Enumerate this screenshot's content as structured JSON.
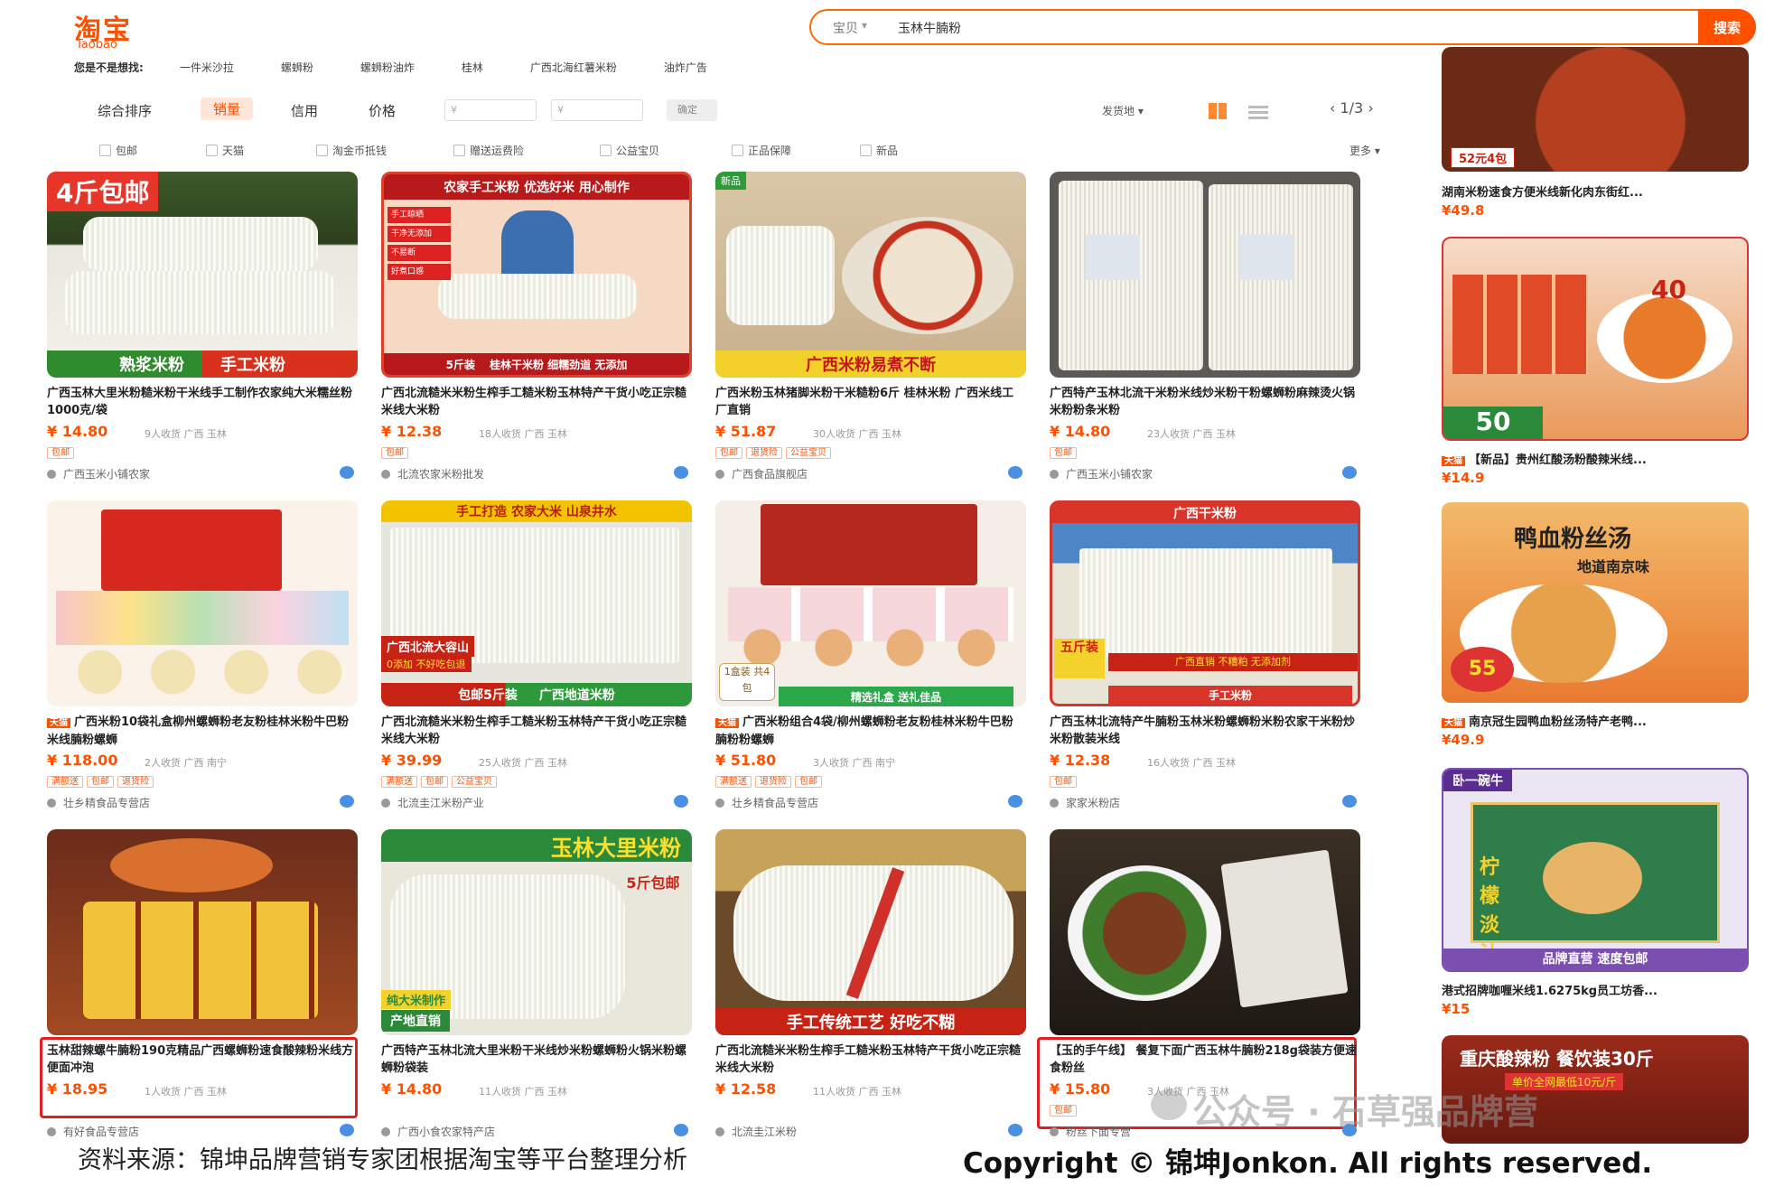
{
  "header": {
    "logo_cn": "淘宝",
    "logo_en": "Taobao",
    "search_category": "宝贝",
    "search_query": "玉林牛腩粉",
    "search_button": "搜索"
  },
  "keywords": {
    "lead": "您是不是想找:",
    "items": [
      "一件米沙拉",
      "螺蛳粉",
      "螺蛳粉油炸",
      "桂林",
      "广西北海红薯米粉",
      "油炸广告"
    ]
  },
  "sortbar": {
    "items": [
      "综合排序",
      "销量",
      "信用",
      "价格"
    ],
    "active": "销量",
    "price_from_placeholder": "¥",
    "price_to_placeholder": "¥",
    "ok_label": "确定",
    "view_select": "发货地",
    "pager": "1/3"
  },
  "filters": {
    "items": [
      "包邮",
      "天猫",
      "淘金币抵钱",
      "赠送运费险",
      "公益宝贝",
      "正品保障",
      "新品"
    ],
    "more": "更多"
  },
  "products": [
    {
      "badge": "4斤包邮",
      "caption_left": "熟浆米粉",
      "caption_right": "手工米粉",
      "title": "广西玉林大里米粉糙米粉干米线手工制作农家纯大米糯丝粉1000克/袋",
      "price": "¥ 14.80",
      "meta": "9人收货  广西 玉林",
      "tags": [
        "包邮"
      ],
      "shop": "广西玉米小铺农家",
      "boxed": false
    },
    {
      "top_text": "农家手工米粉 优选好米 用心制作",
      "tags_img": [
        "手工晾晒",
        "干净无添加",
        "不易断",
        "好煮口感"
      ],
      "caption_left": "5斤装",
      "caption_right": "桂林干米粉 细糯劲道 无添加",
      "title": "广西北流糙米米粉生榨手工糙米粉玉林特产干货小吃正宗糙米线大米粉",
      "price": "¥ 12.38",
      "meta": "18人收货  广西 玉林",
      "tags": [
        "包邮"
      ],
      "shop": "北流农家米粉批发",
      "boxed": false
    },
    {
      "corner": "新品",
      "caption_left": "广西米粉易煮不断",
      "title": "广西米粉玉林猪脚米粉干米糙粉6斤 桂林米粉 广西米线工厂直销",
      "price": "¥ 51.87",
      "meta": "30人收货  广西 玉林",
      "tags": [
        "包邮",
        "退货险",
        "公益宝贝"
      ],
      "shop": "广西食品旗舰店",
      "boxed": false
    },
    {
      "title": "广西特产玉林北流干米粉米线炒米粉干粉螺蛳粉麻辣烫火锅米粉粉条米粉",
      "price": "¥ 14.80",
      "meta": "23人收货  广西 玉林",
      "tags": [
        "包邮"
      ],
      "shop": "广西玉米小铺农家",
      "boxed": false
    },
    {
      "title": "广西米粉10袋礼盒柳州螺蛳粉老友粉桂林米粉牛巴粉米线腩粉螺蛳",
      "price": "¥ 118.00",
      "meta": "2人收货  广西 南宁",
      "tags": [
        "满额送",
        "包邮",
        "退货险"
      ],
      "shop": "壮乡精食品专营店",
      "boxed": false,
      "label": "天猫"
    },
    {
      "top_text": "手工打造 农家大米 山泉井水",
      "mid_text": "广西北流大容山",
      "mid_text2": "0添加 不好吃包退",
      "caption_left": "包邮5斤装",
      "caption_right": "广西地道米粉",
      "title": "广西北流糙米米粉生榨手工糙米粉玉林特产干货小吃正宗糙米线大米粉",
      "price": "¥ 39.99",
      "meta": "25人收货  广西 玉林",
      "tags": [
        "满额送",
        "包邮",
        "公益宝贝"
      ],
      "shop": "北流圭江米粉产业",
      "boxed": false
    },
    {
      "corner_text": "1盒装 共4包",
      "caption_left": "精选礼盒 送礼佳品",
      "title": "广西米粉组合4袋/柳州螺蛳粉老友粉桂林米粉牛巴粉腩粉粉螺蛳",
      "price": "¥ 51.80",
      "meta": "3人收货  广西 南宁",
      "tags": [
        "满额送",
        "退货险",
        "包邮"
      ],
      "shop": "壮乡精食品专营店",
      "boxed": false,
      "label": "天猫"
    },
    {
      "top_text": "广西干米粉",
      "corner_text": "五斤装",
      "caption_left": "广西直销 不糟粕 无添加剂",
      "caption_right": "手工米粉",
      "title": "广西玉林北流特产牛腩粉玉林米粉螺蛳粉米粉农家干米粉炒米粉散装米线",
      "price": "¥ 12.38",
      "meta": "16人收货  广西 玉林",
      "tags": [
        "包邮"
      ],
      "shop": "家家米粉店",
      "boxed": false
    },
    {
      "title": "玉林甜辣螺牛腩粉190克精品广西螺蛳粉速食酸辣粉米线方便面冲泡",
      "price": "¥ 18.95",
      "meta": "1人收货  广西 玉林",
      "tags": [],
      "shop": "有好食品专营店",
      "boxed": true
    },
    {
      "top_text": "玉林大里米粉",
      "corner_text": "5斤包邮",
      "mid_text": "纯大米制作",
      "caption_left": "产地直销",
      "title": "广西特产玉林北流大里米粉干米线炒米粉螺蛳粉火锅米粉螺蛳粉袋装",
      "price": "¥ 14.80",
      "meta": "11人收货  广西 玉林",
      "tags": [],
      "shop": "广西小食农家特产店",
      "boxed": false
    },
    {
      "caption_left": "手工传统工艺 好吃不糊",
      "title": "广西北流糙米米粉生榨手工糙米粉玉林特产干货小吃正宗糙米线大米粉",
      "price": "¥ 12.58",
      "meta": "11人收货  广西 玉林",
      "tags": [],
      "shop": "北流圭江米粉",
      "boxed": false
    },
    {
      "title": "【玉的手午线】 餐复下面广西玉林牛腩粉218g袋装方便速食粉丝",
      "price": "¥ 15.80",
      "meta": "3人收货  广西 玉林",
      "tags": [
        "包邮"
      ],
      "shop": "粉丝下面专营",
      "boxed": true
    }
  ],
  "sidebar": [
    {
      "caption": "52元4包",
      "title": "湖南米粉速食方便米线新化肉东街红...",
      "price": "¥49.8"
    },
    {
      "caption": "50",
      "big": "40",
      "title": "【新品】贵州红酸汤粉酸辣米线...",
      "price": "¥14.9",
      "label": "天猫"
    },
    {
      "headline": "鸭血粉丝汤",
      "sub": "地道南京味",
      "price_img": "55",
      "title": "南京冠生园鸭血粉丝汤特产老鸭...",
      "price": "¥49.9",
      "label": "天猫"
    },
    {
      "top": "卧一碗牛",
      "brand": "柠檬淡汁",
      "caption": "品牌直营 速度包邮",
      "title": "港式招牌咖喱米线1.6275kg员工坊香...",
      "price": "¥15"
    },
    {
      "headline": "重庆酸辣粉 餐饮装30斤",
      "sub": "单价全网最低10元/斤"
    }
  ],
  "watermark": {
    "text": "公众号 · 石草强品牌营"
  },
  "footer": {
    "left": "资料来源：锦坤品牌营销专家团根据淘宝等平台整理分析",
    "right": "Copyright © 锦坤Jonkon. All rights reserved."
  },
  "colors": {
    "accent": "#ff5000",
    "price": "#ff5000",
    "highlight_box": "#e02020"
  }
}
